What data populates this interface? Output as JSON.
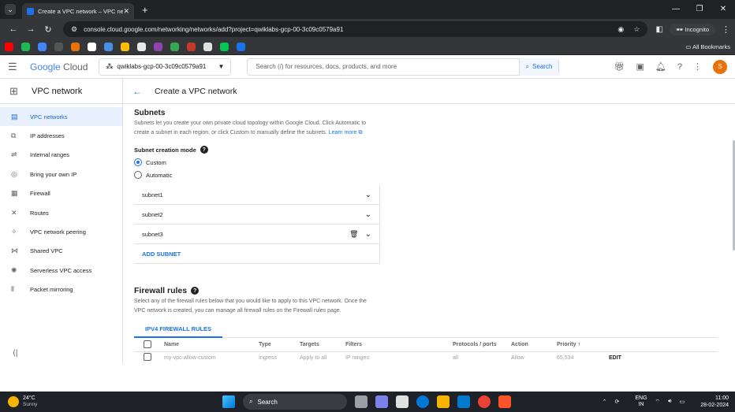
{
  "browser": {
    "tab_title": "Create a VPC network – VPC ne",
    "url": "console.cloud.google.com/networking/networks/add?project=qwiklabs-gcp-00-3c09c0579a91",
    "incognito_label": "Incognito",
    "all_bookmarks": "All Bookmarks",
    "bookmark_colors": [
      "#ff0000",
      "#1db954",
      "#4285f4",
      "#555555",
      "#e8710a",
      "#ffffff",
      "#4a90e2",
      "#fbbc04",
      "#e8e8e8",
      "#8e44ad",
      "#34a853",
      "#c0392b",
      "#e0e0e0",
      "#00c853",
      "#1a73e8"
    ]
  },
  "header": {
    "logo_google": "Google",
    "logo_cloud": "Cloud",
    "project": "qwiklabs-gcp-00-3c09c0579a91",
    "search_placeholder": "Search (/) for resources, docs, products, and more",
    "search_button": "Search",
    "avatar_letter": "S"
  },
  "sidebar": {
    "title": "VPC network",
    "items": [
      {
        "label": "VPC networks",
        "icon": "▤",
        "active": true
      },
      {
        "label": "IP addresses",
        "icon": "⧉"
      },
      {
        "label": "Internal ranges",
        "icon": "⇌"
      },
      {
        "label": "Bring your own IP",
        "icon": "◎"
      },
      {
        "label": "Firewall",
        "icon": "▦"
      },
      {
        "label": "Routes",
        "icon": "✕"
      },
      {
        "label": "VPC network peering",
        "icon": "✧"
      },
      {
        "label": "Shared VPC",
        "icon": "⋈"
      },
      {
        "label": "Serverless VPC access",
        "icon": "✺"
      },
      {
        "label": "Packet mirroring",
        "icon": "⦀"
      }
    ]
  },
  "page": {
    "title": "Create a VPC network",
    "subnets_heading": "Subnets",
    "subnets_desc": "Subnets let you create your own private cloud topology within Google Cloud. Click Automatic to create a subnet in each region, or click Custom to manually define the subnets.",
    "learn_more": "Learn more",
    "mode_label": "Subnet creation mode",
    "mode_custom": "Custom",
    "mode_automatic": "Automatic",
    "subnets": [
      "subnet1",
      "subnet2",
      "subnet3"
    ],
    "add_subnet": "ADD SUBNET",
    "firewall_heading": "Firewall rules",
    "firewall_desc": "Select any of the firewall rules below that you would like to apply to this VPC network. Once the VPC network is created, you can manage all firewall rules on the Firewall rules page.",
    "firewall_tab": "IPV4 FIREWALL RULES",
    "columns": {
      "name": "Name",
      "type": "Type",
      "targets": "Targets",
      "filters": "Filters",
      "protocols": "Protocols / ports",
      "action": "Action",
      "priority": "Priority"
    },
    "partial_row": {
      "name": "my-vpc-allow-custom",
      "type": "Ingress",
      "targets": "Apply to all",
      "filters": "IP ranges:",
      "protocols": "all",
      "action": "Allow",
      "priority": "65,534",
      "edit": "EDIT"
    }
  },
  "taskbar": {
    "temp": "24°C",
    "weather": "Sunny",
    "search": "Search",
    "lang1": "ENG",
    "lang2": "IN",
    "time": "11:00",
    "date": "28-02-2024",
    "badge": "1"
  }
}
